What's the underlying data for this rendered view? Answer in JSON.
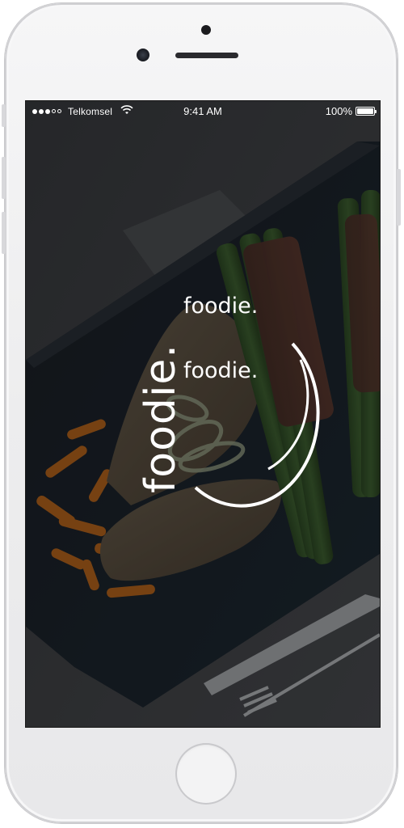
{
  "status_bar": {
    "carrier": "Telkomsel",
    "time": "9:41 AM",
    "battery": "100%",
    "battery_level": 1.0,
    "signal_bars": 3,
    "signal_max": 5
  },
  "splash": {
    "logo_vertical": "foodie.",
    "logo_line_1": "foodie.",
    "logo_line_2": "foodie."
  },
  "device": {
    "model": "iphone",
    "color": "silver"
  },
  "icons": {
    "wifi": "wifi-icon",
    "battery": "battery-icon",
    "signal": "signal-dots-icon",
    "camera": "front-camera-icon",
    "home": "home-button-icon"
  }
}
